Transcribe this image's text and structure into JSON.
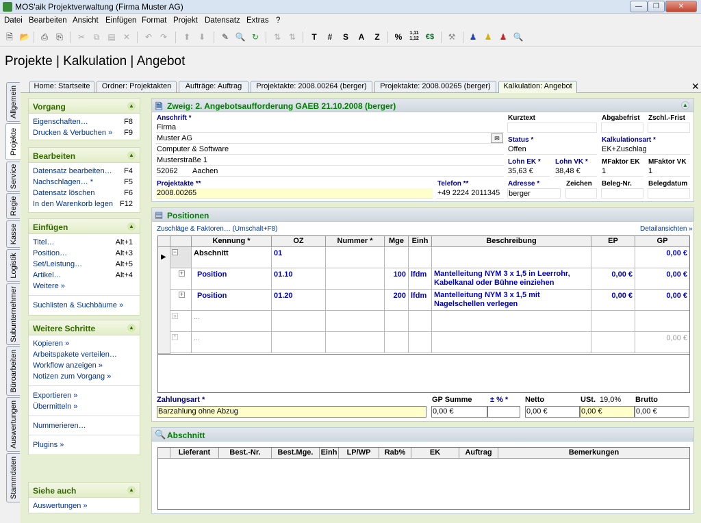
{
  "window": {
    "title": "MOS'aik Projektverwaltung (Firma Muster AG)"
  },
  "menu": [
    "Datei",
    "Bearbeiten",
    "Ansicht",
    "Einfügen",
    "Format",
    "Projekt",
    "Datensatz",
    "Extras",
    "?"
  ],
  "toolbar": {
    "letters": [
      "T",
      "#",
      "S",
      "A",
      "Z",
      "%",
      "1,11\n1,12",
      "€$"
    ]
  },
  "header": {
    "title": "Projekte | Kalkulation | Angebot"
  },
  "vertical_tabs": [
    "Allgemein",
    "Projekte",
    "Service",
    "Regie",
    "Kasse",
    "Logistik",
    "Subunternehmer",
    "Büroarbeiten",
    "Auswertungen",
    "Stammdaten"
  ],
  "doc_tabs": [
    "Home: Startseite",
    "Ordner: Projektakten",
    "Aufträge: Auftrag",
    "Projektakte: 2008.00264 (berger)",
    "Projektakte: 2008.00265 (berger)",
    "Kalkulation: Angebot"
  ],
  "sidebar": {
    "vorgang": {
      "title": "Vorgang",
      "items": [
        {
          "label": "Eigenschaften…",
          "key": "F8"
        },
        {
          "label": "Drucken & Verbuchen »",
          "key": "F9"
        }
      ]
    },
    "bearbeiten": {
      "title": "Bearbeiten",
      "items": [
        {
          "label": "Datensatz bearbeiten…",
          "key": "F4"
        },
        {
          "label": "Nachschlagen… *",
          "key": "F5"
        },
        {
          "label": "Datensatz löschen",
          "key": "F6"
        },
        {
          "label": "In den Warenkorb legen",
          "key": "F12"
        }
      ]
    },
    "einfuegen": {
      "title": "Einfügen",
      "items": [
        {
          "label": "Titel…",
          "key": "Alt+1"
        },
        {
          "label": "Position…",
          "key": "Alt+3"
        },
        {
          "label": "Set/Leistung…",
          "key": "Alt+5"
        },
        {
          "label": "Artikel…",
          "key": "Alt+4"
        },
        {
          "label": "Weitere »",
          "key": ""
        }
      ],
      "extra": "Suchlisten & Suchbäume »"
    },
    "weitere": {
      "title": "Weitere Schritte",
      "items": [
        "Kopieren »",
        "Arbeitspakete verteilen…",
        "Workflow anzeigen »",
        "Notizen zum Vorgang »",
        "Exportieren »",
        "Übermitteln »",
        "Nummerieren…",
        "Plugins »"
      ]
    },
    "siehe": {
      "title": "Siehe auch",
      "items": [
        "Auswertungen »"
      ]
    }
  },
  "zweig": {
    "title": "Zweig: 2. Angebotsaufforderung GAEB 21.10.2008 (berger)",
    "anschrift_label": "Anschrift *",
    "anschrift": [
      "Firma",
      "Muster AG",
      "Computer & Software",
      "Musterstraße 1"
    ],
    "plz": "52062",
    "ort": "Aachen",
    "projektakte_label": "Projektakte **",
    "projektakte": "2008.00265",
    "telefon_label": "Telefon **",
    "telefon": "+49 2224 2011345",
    "kurztext_label": "Kurztext",
    "kurztext": "",
    "abgabefrist_label": "Abgabefrist",
    "zschl_label": "Zschl.-Frist",
    "status_label": "Status *",
    "status": "Offen",
    "kalkart_label": "Kalkulationsart *",
    "kalkart": "EK+Zuschlag",
    "lohnek_label": "Lohn EK *",
    "lohnek": "35,63 €",
    "lohnvk_label": "Lohn VK *",
    "lohnvk": "38,48 €",
    "mfek_label": "MFaktor EK",
    "mfek": "1",
    "mfvk_label": "MFaktor VK",
    "mfvk": "1",
    "adresse_label": "Adresse *",
    "adresse": "berger",
    "zeichen_label": "Zeichen",
    "belegnr_label": "Beleg-Nr.",
    "belegdatum_label": "Belegdatum"
  },
  "positionen": {
    "title": "Positionen",
    "zuschlaege": "Zuschläge & Faktoren… (Umschalt+F8)",
    "detail": "Detailansichten »",
    "columns": [
      "Kennung *",
      "OZ",
      "Nummer *",
      "Mge",
      "Einh",
      "Beschreibung",
      "EP",
      "GP"
    ],
    "rows": [
      {
        "kennung": "Abschnitt",
        "oz": "01",
        "nummer": "",
        "mge": "",
        "einh": "",
        "beschr": "",
        "ep": "",
        "gp": "0,00 €"
      },
      {
        "kennung": "Position",
        "oz": "01.10",
        "nummer": "",
        "mge": "100",
        "einh": "lfdm",
        "beschr": "Mantelleitung NYM 3 x 1,5 in Leerrohr, Kabelkanal oder Bühne einziehen",
        "ep": "0,00 €",
        "gp": "0,00 €"
      },
      {
        "kennung": "Position",
        "oz": "01.20",
        "nummer": "",
        "mge": "200",
        "einh": "lfdm",
        "beschr": "Mantelleitung NYM 3 x 1,5 mit Nagelschellen verlegen",
        "ep": "0,00 €",
        "gp": "0,00 €"
      },
      {
        "kennung": "...",
        "oz": "",
        "nummer": "",
        "mge": "",
        "einh": "",
        "beschr": "",
        "ep": "",
        "gp": ""
      },
      {
        "kennung": "...",
        "oz": "",
        "nummer": "",
        "mge": "",
        "einh": "",
        "beschr": "",
        "ep": "",
        "gp": "0,00 €"
      }
    ],
    "zahlungsart_label": "Zahlungsart *",
    "zahlungsart": "Barzahlung ohne Abzug",
    "gpsumme_label": "GP Summe",
    "gpsumme": "0,00 €",
    "pct_label": "± % *",
    "pct": "",
    "netto_label": "Netto",
    "netto": "0,00 €",
    "ust_label": "USt.",
    "ust_rate": "19,0%",
    "ust": "0,00 €",
    "brutto_label": "Brutto",
    "brutto": "0,00 €"
  },
  "abschnitt": {
    "title": "Abschnitt",
    "columns": [
      "Lieferant",
      "Best.-Nr.",
      "Best.Mge.",
      "Einh",
      "LP/WP",
      "Rab%",
      "EK",
      "Auftrag",
      "Bemerkungen"
    ]
  }
}
